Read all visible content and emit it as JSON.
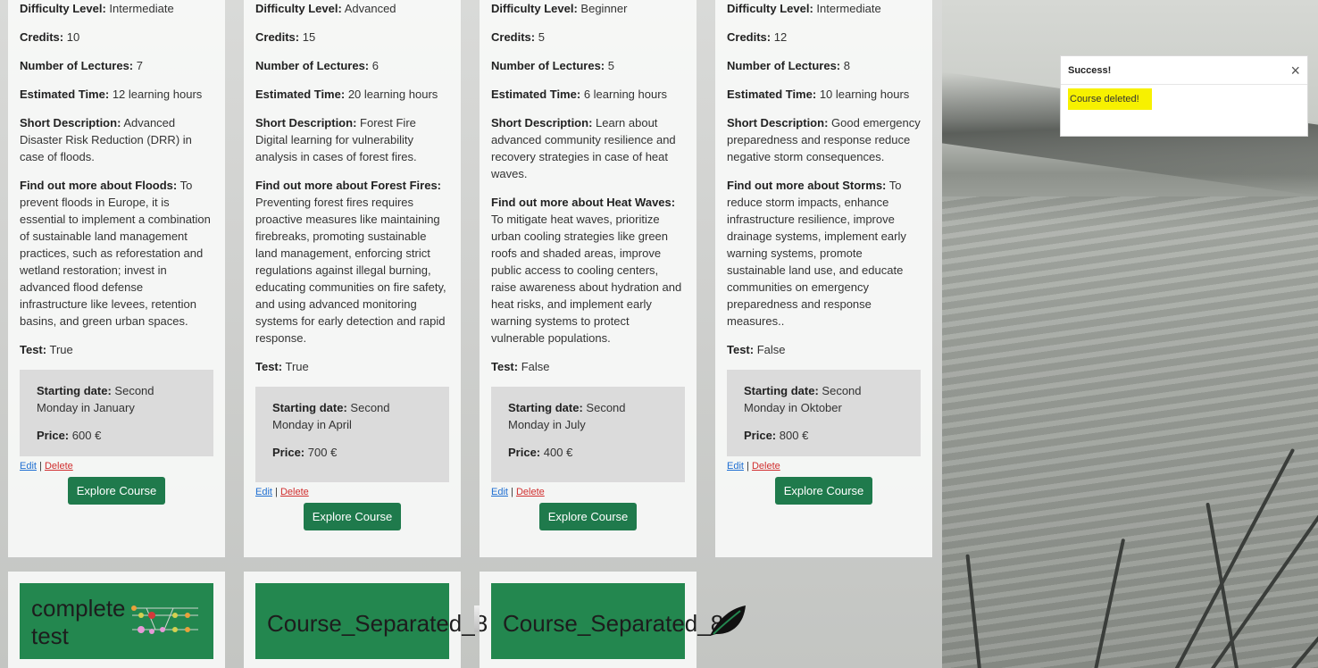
{
  "courses": [
    {
      "difficulty_label": "Difficulty Level:",
      "difficulty": "Intermediate",
      "credits_label": "Credits:",
      "credits": "10",
      "lectures_label": "Number of Lectures:",
      "lectures": "7",
      "time_label": "Estimated Time:",
      "time": "12 learning hours",
      "desc_label": "Short Description:",
      "desc": "Advanced Disaster Risk Reduction (DRR) in case of floods.",
      "more_label": "Find out more about Floods:",
      "more": "To prevent floods in Europe, it is essential to implement a combination of sustainable land management practices, such as reforestation and wetland restoration; invest in advanced flood defense infrastructure like levees, retention basins, and green urban spaces.",
      "test_label": "Test:",
      "test": "True",
      "start_label": "Starting date:",
      "start": "Second Monday in January",
      "price_label": "Price:",
      "price": "600 €",
      "edit": "Edit",
      "sep": "|",
      "delete": "Delete",
      "explore": "Explore Course"
    },
    {
      "difficulty_label": "Difficulty Level:",
      "difficulty": "Advanced",
      "credits_label": "Credits:",
      "credits": "15",
      "lectures_label": "Number of Lectures:",
      "lectures": "6",
      "time_label": "Estimated Time:",
      "time": "20 learning hours",
      "desc_label": "Short Description:",
      "desc": "Forest Fire Digital learning for vulnerability analysis in cases of forest fires.",
      "more_label": "Find out more about Forest Fires:",
      "more": "Preventing forest fires requires proactive measures like maintaining firebreaks, promoting sustainable land management, enforcing strict regulations against illegal burning, educating communities on fire safety, and using advanced monitoring systems for early detection and rapid response.",
      "test_label": "Test:",
      "test": "True",
      "start_label": "Starting date:",
      "start": "Second Monday in April",
      "price_label": "Price:",
      "price": "700 €",
      "edit": "Edit",
      "sep": "|",
      "delete": "Delete",
      "explore": "Explore Course"
    },
    {
      "difficulty_label": "Difficulty Level:",
      "difficulty": "Beginner",
      "credits_label": "Credits:",
      "credits": "5",
      "lectures_label": "Number of Lectures:",
      "lectures": "5",
      "time_label": "Estimated Time:",
      "time": "6 learning hours",
      "desc_label": "Short Description:",
      "desc": "Learn about advanced community resilience and recovery strategies in case of heat waves.",
      "more_label": "Find out more about Heat Waves:",
      "more": "To mitigate heat waves, prioritize urban cooling strategies like green roofs and shaded areas, improve public access to cooling centers, raise awareness about hydration and heat risks, and implement early warning systems to protect vulnerable populations.",
      "test_label": "Test:",
      "test": "False",
      "start_label": "Starting date:",
      "start": "Second Monday in July",
      "price_label": "Price:",
      "price": "400 €",
      "edit": "Edit",
      "sep": "|",
      "delete": "Delete",
      "explore": "Explore Course"
    },
    {
      "difficulty_label": "Difficulty Level:",
      "difficulty": "Intermediate",
      "credits_label": "Credits:",
      "credits": "12",
      "lectures_label": "Number of Lectures:",
      "lectures": "8",
      "time_label": "Estimated Time:",
      "time": "10 learning hours",
      "desc_label": "Short Description:",
      "desc": "Good emergency preparedness and response reduce negative storm consequences.",
      "more_label": "Find out more about Storms:",
      "more": "To reduce storm impacts, enhance infrastructure resilience, improve drainage systems, implement early warning systems, promote sustainable land use, and educate communities on emergency preparedness and response measures..",
      "test_label": "Test:",
      "test": "False",
      "start_label": "Starting date:",
      "start": "Second Monday in Oktober",
      "price_label": "Price:",
      "price": "800 €",
      "edit": "Edit",
      "sep": "|",
      "delete": "Delete",
      "explore": "Explore Course"
    }
  ],
  "thumbnails": [
    {
      "title_line1": "complete",
      "title_line2": "test",
      "icon": "network-diagram-icon"
    },
    {
      "title": "Course_Separated_8",
      "icon": "broken-image-icon"
    },
    {
      "title": "Course_Separated_8",
      "icon": "leaf-icon"
    }
  ],
  "toast": {
    "title": "Success!",
    "message": "Course deleted!",
    "close": "×"
  },
  "colors": {
    "button_green": "#1f7a4c",
    "thumbnail_green": "#23874f",
    "toast_highlight": "#f7f100",
    "edit_link": "#1f6fd2",
    "delete_link": "#d12f2f"
  }
}
